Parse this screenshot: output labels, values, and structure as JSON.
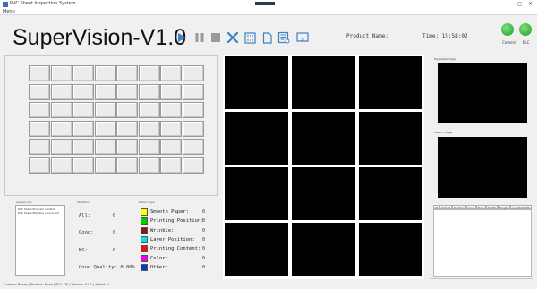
{
  "window": {
    "title": "PVC Sheet Inspection System",
    "menu": "Menu",
    "controls": {
      "minimize": "–",
      "maximize": "◻",
      "close": "✕"
    }
  },
  "header": {
    "brand": "SuperVision-V1.0",
    "product_label": "Product Name:",
    "time_label": "Time: 15:58:02",
    "lamps": [
      {
        "label": "Camera",
        "color": "#2bb52b"
      },
      {
        "label": "PLC",
        "color": "#2bb52b"
      }
    ],
    "tools": [
      "play-icon",
      "pause-icon",
      "stop-icon",
      "tools-icon",
      "calculator-icon",
      "document-icon",
      "report-icon",
      "screen-icon"
    ],
    "accent": "#3b82c4"
  },
  "grid": {
    "rows": 6,
    "cols": 8
  },
  "info": {
    "title": "System Info",
    "lines": [
      "PVC Sheet Program started",
      "PVC Sheet Machine connected"
    ]
  },
  "stats": {
    "title": "Statistics",
    "items": [
      {
        "label": "All:",
        "value": "0"
      },
      {
        "label": "Good:",
        "value": "0"
      },
      {
        "label": "NG:",
        "value": "0"
      }
    ],
    "quality_label": "Good Quality: 0.00%"
  },
  "legend": {
    "title": "Defect Type",
    "items": [
      {
        "name": "Smooth Paper:",
        "color": "#ffff00",
        "value": "0"
      },
      {
        "name": "Printing Position:",
        "color": "#00cc00",
        "value": "0"
      },
      {
        "name": "Wrinkle:",
        "color": "#7a1f1f",
        "value": "0"
      },
      {
        "name": "Layer Position:",
        "color": "#00e5e5",
        "value": "0"
      },
      {
        "name": "Printing Content:",
        "color": "#ee1111",
        "value": "0"
      },
      {
        "name": "Color:",
        "color": "#ee00ee",
        "value": "0"
      },
      {
        "name": "Other:",
        "color": "#1133cc",
        "value": "0"
      }
    ]
  },
  "side": {
    "template_label": "Template Image",
    "defect_label": "Defect Image",
    "tabs": [
      "ID",
      "Defect",
      "Position",
      "Area",
      "Time",
      "Width",
      "Height",
      "Length/Width"
    ]
  },
  "status": {
    "text": "Camera: Ready | Product: None | PLC: OK | Version: V1.0 | Speed: 0"
  }
}
